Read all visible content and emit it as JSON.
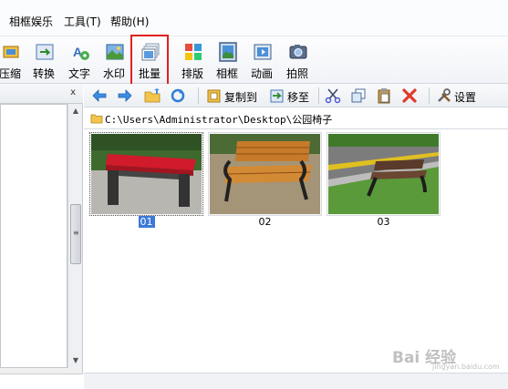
{
  "menu": {
    "items": [
      {
        "label": "相框娱乐"
      },
      {
        "label": "工具(T)"
      },
      {
        "label": "帮助(H)"
      }
    ]
  },
  "toolbar": {
    "items": [
      {
        "label": "压缩",
        "icon": "compress-icon"
      },
      {
        "label": "转换",
        "icon": "convert-icon"
      },
      {
        "label": "文字",
        "icon": "text-icon"
      },
      {
        "label": "水印",
        "icon": "watermark-icon"
      },
      {
        "label": "批量",
        "icon": "batch-icon",
        "selected": true
      },
      {
        "label": "排版",
        "icon": "layout-icon"
      },
      {
        "label": "相框",
        "icon": "frame-icon"
      },
      {
        "label": "动画",
        "icon": "animation-icon"
      },
      {
        "label": "拍照",
        "icon": "camera-icon"
      }
    ]
  },
  "left_pane": {
    "close_label": "x"
  },
  "file_toolbar": {
    "copy_to_label": "复制到",
    "move_to_label": "移至",
    "settings_label": "设置"
  },
  "address": {
    "path": "C:\\Users\\Administrator\\Desktop\\公园椅子"
  },
  "thumbnails": [
    {
      "name": "01",
      "selected": true
    },
    {
      "name": "02",
      "selected": false
    },
    {
      "name": "03",
      "selected": false
    }
  ],
  "watermark": {
    "text": "Bai 经验",
    "sub": "jingyan.baidu.com"
  },
  "colors": {
    "selection": "#3b7ad9",
    "highlight_box": "#e02020"
  }
}
